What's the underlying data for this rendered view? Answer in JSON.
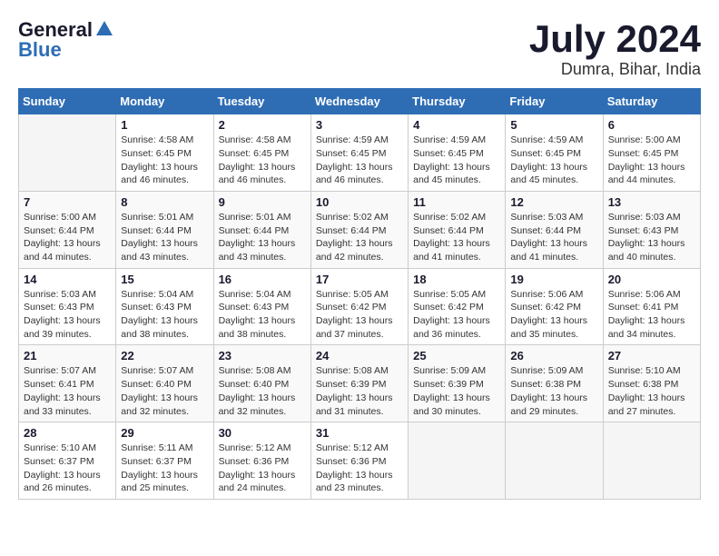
{
  "header": {
    "logo_general": "General",
    "logo_blue": "Blue",
    "month_year": "July 2024",
    "location": "Dumra, Bihar, India"
  },
  "weekdays": [
    "Sunday",
    "Monday",
    "Tuesday",
    "Wednesday",
    "Thursday",
    "Friday",
    "Saturday"
  ],
  "weeks": [
    [
      {
        "day": "",
        "sunrise": "",
        "sunset": "",
        "daylight": ""
      },
      {
        "day": "1",
        "sunrise": "Sunrise: 4:58 AM",
        "sunset": "Sunset: 6:45 PM",
        "daylight": "Daylight: 13 hours and 46 minutes."
      },
      {
        "day": "2",
        "sunrise": "Sunrise: 4:58 AM",
        "sunset": "Sunset: 6:45 PM",
        "daylight": "Daylight: 13 hours and 46 minutes."
      },
      {
        "day": "3",
        "sunrise": "Sunrise: 4:59 AM",
        "sunset": "Sunset: 6:45 PM",
        "daylight": "Daylight: 13 hours and 46 minutes."
      },
      {
        "day": "4",
        "sunrise": "Sunrise: 4:59 AM",
        "sunset": "Sunset: 6:45 PM",
        "daylight": "Daylight: 13 hours and 45 minutes."
      },
      {
        "day": "5",
        "sunrise": "Sunrise: 4:59 AM",
        "sunset": "Sunset: 6:45 PM",
        "daylight": "Daylight: 13 hours and 45 minutes."
      },
      {
        "day": "6",
        "sunrise": "Sunrise: 5:00 AM",
        "sunset": "Sunset: 6:45 PM",
        "daylight": "Daylight: 13 hours and 44 minutes."
      }
    ],
    [
      {
        "day": "7",
        "sunrise": "Sunrise: 5:00 AM",
        "sunset": "Sunset: 6:44 PM",
        "daylight": "Daylight: 13 hours and 44 minutes."
      },
      {
        "day": "8",
        "sunrise": "Sunrise: 5:01 AM",
        "sunset": "Sunset: 6:44 PM",
        "daylight": "Daylight: 13 hours and 43 minutes."
      },
      {
        "day": "9",
        "sunrise": "Sunrise: 5:01 AM",
        "sunset": "Sunset: 6:44 PM",
        "daylight": "Daylight: 13 hours and 43 minutes."
      },
      {
        "day": "10",
        "sunrise": "Sunrise: 5:02 AM",
        "sunset": "Sunset: 6:44 PM",
        "daylight": "Daylight: 13 hours and 42 minutes."
      },
      {
        "day": "11",
        "sunrise": "Sunrise: 5:02 AM",
        "sunset": "Sunset: 6:44 PM",
        "daylight": "Daylight: 13 hours and 41 minutes."
      },
      {
        "day": "12",
        "sunrise": "Sunrise: 5:03 AM",
        "sunset": "Sunset: 6:44 PM",
        "daylight": "Daylight: 13 hours and 41 minutes."
      },
      {
        "day": "13",
        "sunrise": "Sunrise: 5:03 AM",
        "sunset": "Sunset: 6:43 PM",
        "daylight": "Daylight: 13 hours and 40 minutes."
      }
    ],
    [
      {
        "day": "14",
        "sunrise": "Sunrise: 5:03 AM",
        "sunset": "Sunset: 6:43 PM",
        "daylight": "Daylight: 13 hours and 39 minutes."
      },
      {
        "day": "15",
        "sunrise": "Sunrise: 5:04 AM",
        "sunset": "Sunset: 6:43 PM",
        "daylight": "Daylight: 13 hours and 38 minutes."
      },
      {
        "day": "16",
        "sunrise": "Sunrise: 5:04 AM",
        "sunset": "Sunset: 6:43 PM",
        "daylight": "Daylight: 13 hours and 38 minutes."
      },
      {
        "day": "17",
        "sunrise": "Sunrise: 5:05 AM",
        "sunset": "Sunset: 6:42 PM",
        "daylight": "Daylight: 13 hours and 37 minutes."
      },
      {
        "day": "18",
        "sunrise": "Sunrise: 5:05 AM",
        "sunset": "Sunset: 6:42 PM",
        "daylight": "Daylight: 13 hours and 36 minutes."
      },
      {
        "day": "19",
        "sunrise": "Sunrise: 5:06 AM",
        "sunset": "Sunset: 6:42 PM",
        "daylight": "Daylight: 13 hours and 35 minutes."
      },
      {
        "day": "20",
        "sunrise": "Sunrise: 5:06 AM",
        "sunset": "Sunset: 6:41 PM",
        "daylight": "Daylight: 13 hours and 34 minutes."
      }
    ],
    [
      {
        "day": "21",
        "sunrise": "Sunrise: 5:07 AM",
        "sunset": "Sunset: 6:41 PM",
        "daylight": "Daylight: 13 hours and 33 minutes."
      },
      {
        "day": "22",
        "sunrise": "Sunrise: 5:07 AM",
        "sunset": "Sunset: 6:40 PM",
        "daylight": "Daylight: 13 hours and 32 minutes."
      },
      {
        "day": "23",
        "sunrise": "Sunrise: 5:08 AM",
        "sunset": "Sunset: 6:40 PM",
        "daylight": "Daylight: 13 hours and 32 minutes."
      },
      {
        "day": "24",
        "sunrise": "Sunrise: 5:08 AM",
        "sunset": "Sunset: 6:39 PM",
        "daylight": "Daylight: 13 hours and 31 minutes."
      },
      {
        "day": "25",
        "sunrise": "Sunrise: 5:09 AM",
        "sunset": "Sunset: 6:39 PM",
        "daylight": "Daylight: 13 hours and 30 minutes."
      },
      {
        "day": "26",
        "sunrise": "Sunrise: 5:09 AM",
        "sunset": "Sunset: 6:38 PM",
        "daylight": "Daylight: 13 hours and 29 minutes."
      },
      {
        "day": "27",
        "sunrise": "Sunrise: 5:10 AM",
        "sunset": "Sunset: 6:38 PM",
        "daylight": "Daylight: 13 hours and 27 minutes."
      }
    ],
    [
      {
        "day": "28",
        "sunrise": "Sunrise: 5:10 AM",
        "sunset": "Sunset: 6:37 PM",
        "daylight": "Daylight: 13 hours and 26 minutes."
      },
      {
        "day": "29",
        "sunrise": "Sunrise: 5:11 AM",
        "sunset": "Sunset: 6:37 PM",
        "daylight": "Daylight: 13 hours and 25 minutes."
      },
      {
        "day": "30",
        "sunrise": "Sunrise: 5:12 AM",
        "sunset": "Sunset: 6:36 PM",
        "daylight": "Daylight: 13 hours and 24 minutes."
      },
      {
        "day": "31",
        "sunrise": "Sunrise: 5:12 AM",
        "sunset": "Sunset: 6:36 PM",
        "daylight": "Daylight: 13 hours and 23 minutes."
      },
      {
        "day": "",
        "sunrise": "",
        "sunset": "",
        "daylight": ""
      },
      {
        "day": "",
        "sunrise": "",
        "sunset": "",
        "daylight": ""
      },
      {
        "day": "",
        "sunrise": "",
        "sunset": "",
        "daylight": ""
      }
    ]
  ]
}
